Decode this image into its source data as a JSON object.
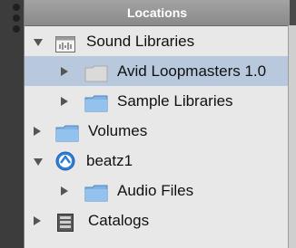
{
  "panel": {
    "title": "Locations"
  },
  "tree": {
    "sound_libraries": "Sound Libraries",
    "avid_loopmasters": "Avid Loopmasters 1.0",
    "sample_libraries": "Sample Libraries",
    "volumes": "Volumes",
    "beatz1": "beatz1",
    "audio_files": "Audio Files",
    "catalogs": "Catalogs"
  },
  "icons": {
    "sound_libraries": "sound-library-icon",
    "avid_loopmasters": "folder-icon",
    "sample_libraries": "folder-icon",
    "volumes": "folder-icon",
    "beatz1": "volume-drive-icon",
    "audio_files": "folder-icon",
    "catalogs": "catalog-icon"
  },
  "colors": {
    "selection": "#b9c9dd",
    "folder_blue": "#7fb3e6",
    "title_bar": "#999999"
  }
}
